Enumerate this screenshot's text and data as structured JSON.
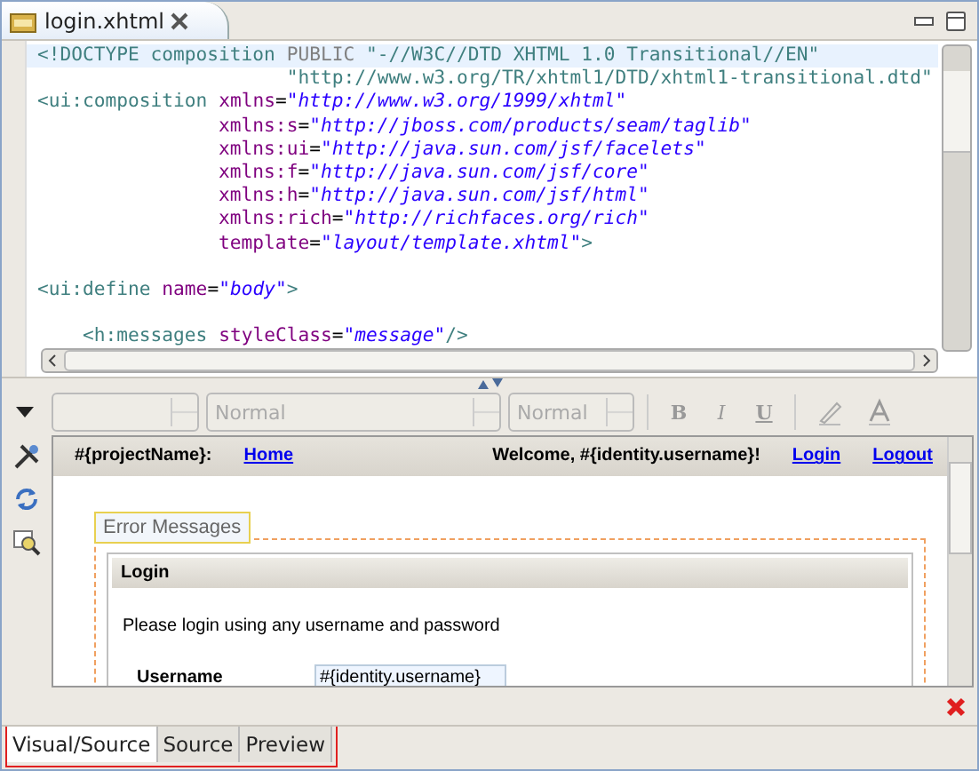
{
  "editor_tab": {
    "title": "login.xhtml",
    "selected": true
  },
  "code_lines": [
    {
      "kind": "code",
      "current": true,
      "segments": [
        {
          "kind": "tag",
          "text": "<!DOCTYPE composition "
        },
        {
          "kind": "keyword",
          "text": "PUBLIC "
        },
        {
          "kind": "doc",
          "text": "\"-//W3C//DTD XHTML 1.0 Transitional//EN\""
        }
      ]
    },
    {
      "kind": "code",
      "current": false,
      "segments": [
        {
          "kind": "doc",
          "text": "                      \"http://www.w3.org/TR/xhtml1/DTD/xhtml1-transitional.dtd\""
        }
      ]
    },
    {
      "kind": "code",
      "current": false,
      "segments": [
        {
          "kind": "tag",
          "text": "<ui:composition "
        },
        {
          "kind": "attr",
          "text": "xmlns"
        },
        {
          "kind": "plain",
          "text": "="
        },
        {
          "kind": "value",
          "text": "\"http://www.w3.org/1999/xhtml\""
        }
      ]
    },
    {
      "kind": "code",
      "current": false,
      "segments": [
        {
          "kind": "attr",
          "text": "                xmlns:s"
        },
        {
          "kind": "plain",
          "text": "="
        },
        {
          "kind": "value",
          "text": "\"http://jboss.com/products/seam/taglib\""
        }
      ]
    },
    {
      "kind": "code",
      "current": false,
      "segments": [
        {
          "kind": "attr",
          "text": "                xmlns:ui"
        },
        {
          "kind": "plain",
          "text": "="
        },
        {
          "kind": "value",
          "text": "\"http://java.sun.com/jsf/facelets\""
        }
      ]
    },
    {
      "kind": "code",
      "current": false,
      "segments": [
        {
          "kind": "attr",
          "text": "                xmlns:f"
        },
        {
          "kind": "plain",
          "text": "="
        },
        {
          "kind": "value",
          "text": "\"http://java.sun.com/jsf/core\""
        }
      ]
    },
    {
      "kind": "code",
      "current": false,
      "segments": [
        {
          "kind": "attr",
          "text": "                xmlns:h"
        },
        {
          "kind": "plain",
          "text": "="
        },
        {
          "kind": "value",
          "text": "\"http://java.sun.com/jsf/html\""
        }
      ]
    },
    {
      "kind": "code",
      "current": false,
      "segments": [
        {
          "kind": "attr",
          "text": "                xmlns:rich"
        },
        {
          "kind": "plain",
          "text": "="
        },
        {
          "kind": "value",
          "text": "\"http://richfaces.org/rich\""
        }
      ]
    },
    {
      "kind": "code",
      "current": false,
      "segments": [
        {
          "kind": "attr",
          "text": "                template"
        },
        {
          "kind": "plain",
          "text": "="
        },
        {
          "kind": "value",
          "text": "\"layout/template.xhtml\""
        },
        {
          "kind": "tag",
          "text": ">"
        }
      ]
    },
    {
      "kind": "blank"
    },
    {
      "kind": "code",
      "current": false,
      "segments": [
        {
          "kind": "tag",
          "text": "<ui:define "
        },
        {
          "kind": "attr",
          "text": "name"
        },
        {
          "kind": "plain",
          "text": "="
        },
        {
          "kind": "value",
          "text": "\"body\""
        },
        {
          "kind": "tag",
          "text": ">"
        }
      ]
    },
    {
      "kind": "blank"
    },
    {
      "kind": "code",
      "current": false,
      "segments": [
        {
          "kind": "tag",
          "text": "    <h:messages "
        },
        {
          "kind": "attr",
          "text": "styleClass"
        },
        {
          "kind": "plain",
          "text": "="
        },
        {
          "kind": "value",
          "text": "\"message\""
        },
        {
          "kind": "tag",
          "text": "/>"
        }
      ]
    }
  ],
  "style_combos": [
    {
      "disabled": true
    },
    {
      "value": "Normal",
      "disabled": true
    },
    {
      "value": "Normal",
      "disabled": true
    }
  ],
  "format_buttons": [
    {
      "label": "B",
      "kind": "bold",
      "disabled": true
    },
    {
      "label": "I",
      "kind": "italic",
      "disabled": true
    },
    {
      "label": "U",
      "kind": "underline",
      "disabled": true
    }
  ],
  "preview": {
    "header": {
      "project": "#{projectName}:",
      "home_link": "Home",
      "welcome": "Welcome, #{identity.username}!",
      "links": [
        "Login",
        "Logout"
      ]
    },
    "error_messages_label": "Error Messages",
    "login_panel": {
      "title": "Login",
      "intro": "Please login using any username and password",
      "fields": [
        {
          "label": "Username",
          "value": "#{identity.username}"
        }
      ]
    }
  },
  "view_tabs": [
    {
      "label": "Visual/Source",
      "selected": true
    },
    {
      "label": "Source",
      "selected": false
    },
    {
      "label": "Preview",
      "selected": false
    }
  ]
}
